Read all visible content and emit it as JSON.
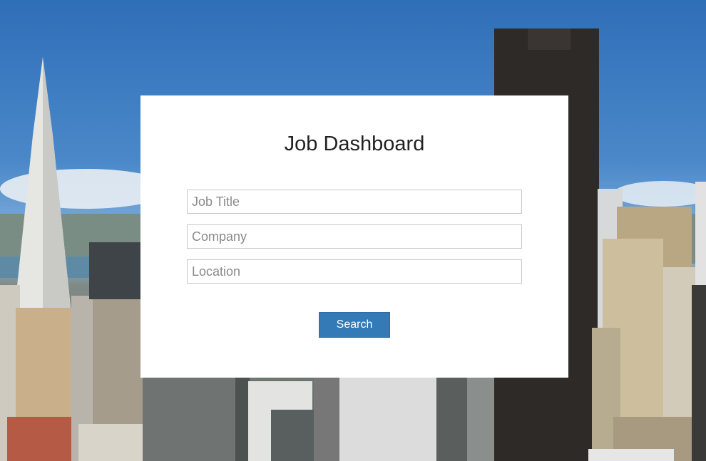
{
  "page": {
    "title": "Job Dashboard"
  },
  "form": {
    "job_title": {
      "placeholder": "Job Title",
      "value": ""
    },
    "company": {
      "placeholder": "Company",
      "value": ""
    },
    "location": {
      "placeholder": "Location",
      "value": ""
    },
    "search_label": "Search"
  },
  "colors": {
    "button_bg": "#337ab7",
    "card_bg": "#ffffff",
    "title_text": "#222222"
  }
}
